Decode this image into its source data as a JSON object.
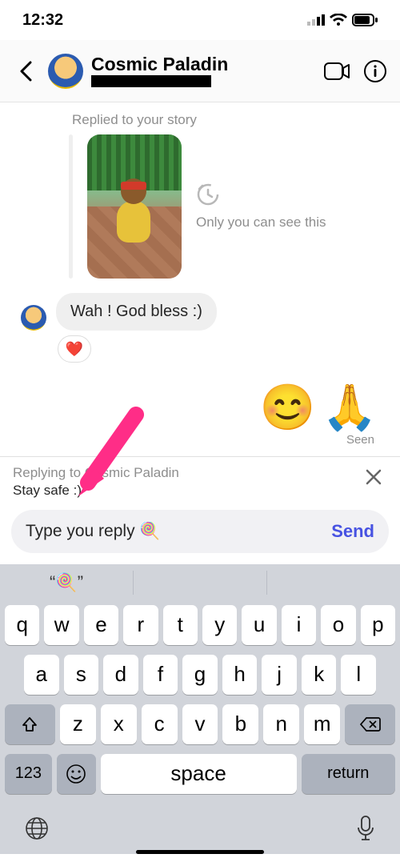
{
  "status": {
    "time": "12:32"
  },
  "header": {
    "title": "Cosmic Paladin"
  },
  "chat": {
    "replied_label": "Replied to your story",
    "story_note": "Only you can see this",
    "message1": "Wah ! God bless :)",
    "heart": "❤️",
    "emoji_smile": "😊",
    "emoji_pray": "🙏",
    "seen": "Seen"
  },
  "reply_context": {
    "who": "Replying to Cosmic Paladin",
    "quote": "Stay safe :)"
  },
  "composer": {
    "value": "Type you reply 🍭",
    "send": "Send"
  },
  "suggestions": {
    "s1": "“🍭”",
    "s2": "",
    "s3": ""
  },
  "keys": {
    "r1": [
      "q",
      "w",
      "e",
      "r",
      "t",
      "y",
      "u",
      "i",
      "o",
      "p"
    ],
    "r2": [
      "a",
      "s",
      "d",
      "f",
      "g",
      "h",
      "j",
      "k",
      "l"
    ],
    "r3": [
      "z",
      "x",
      "c",
      "v",
      "b",
      "n",
      "m"
    ],
    "numbers": "123",
    "space": "space",
    "ret": "return"
  }
}
